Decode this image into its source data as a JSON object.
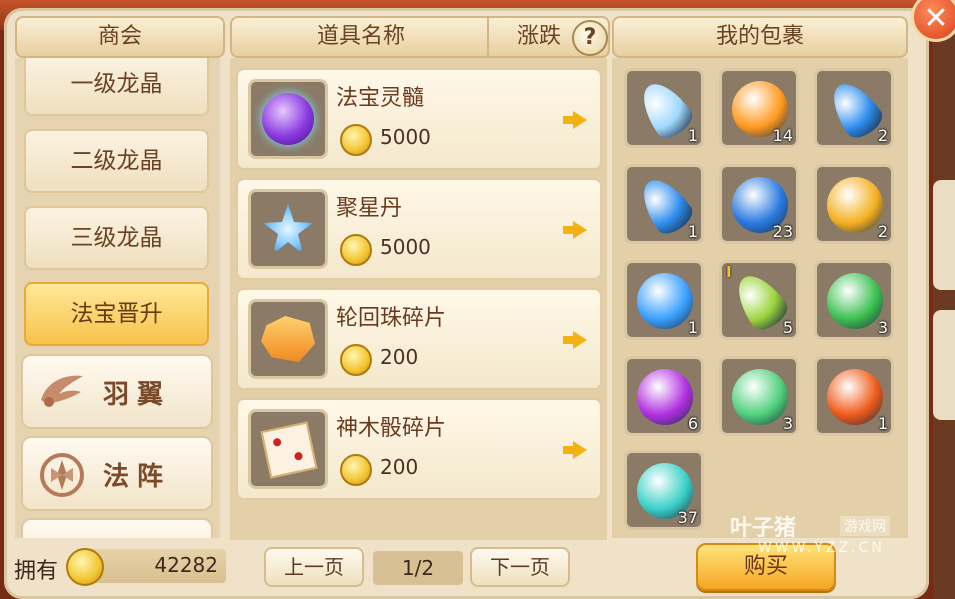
{
  "header": {
    "shop_col": "商会",
    "item_name_col": "道具名称",
    "change_col": "涨跌",
    "help_icon": "?",
    "bag_col": "我的包裹"
  },
  "sidebar": {
    "sub_items": [
      {
        "label": "一级龙晶"
      },
      {
        "label": "二级龙晶"
      },
      {
        "label": "三级龙晶"
      },
      {
        "label": "法宝晋升"
      }
    ],
    "main_items": [
      {
        "label": "羽翼",
        "icon": "wing-icon"
      },
      {
        "label": "法阵",
        "icon": "array-icon"
      }
    ]
  },
  "items": [
    {
      "name": "法宝灵髓",
      "price": "5000",
      "icon": "purple-orb-icon"
    },
    {
      "name": "聚星丹",
      "price": "5000",
      "icon": "star-swirl-icon"
    },
    {
      "name": "轮回珠碎片",
      "price": "200",
      "icon": "orb-fragment-icon"
    },
    {
      "name": "神木骰碎片",
      "price": "200",
      "icon": "dice-fragment-icon"
    }
  ],
  "bag": [
    {
      "count": "1",
      "icon": "ice-crystal-icon",
      "color": "#9fd8ff"
    },
    {
      "count": "14",
      "icon": "fire-orb-icon",
      "color": "#ff9a1f"
    },
    {
      "count": "2",
      "icon": "blue-feather-icon",
      "color": "#2f8ff0"
    },
    {
      "count": "1",
      "icon": "blue-feather-icon",
      "color": "#2f8ff0"
    },
    {
      "count": "23",
      "icon": "blue-orb-icon",
      "color": "#2a7ae0"
    },
    {
      "count": "2",
      "icon": "golden-rose-icon",
      "color": "#f5b020"
    },
    {
      "count": "1",
      "icon": "water-swirl-icon",
      "color": "#3aa0ff"
    },
    {
      "count": "5",
      "icon": "green-crystal-icon",
      "color": "#9bd43a"
    },
    {
      "count": "3",
      "icon": "green-orb-icon",
      "color": "#3cc050"
    },
    {
      "count": "6",
      "icon": "purple-pedestal-orb-icon",
      "color": "#b030e0"
    },
    {
      "count": "3",
      "icon": "rainbow-orb-icon",
      "color": "#4fd07a"
    },
    {
      "count": "1",
      "icon": "fire-spirit-icon",
      "color": "#f05a1a"
    },
    {
      "count": "37",
      "icon": "teal-orb-icon",
      "color": "#3ad0c8"
    }
  ],
  "bag_badge": "I",
  "footer": {
    "own_label": "拥有",
    "own_value": "42282",
    "prev_label": "上一页",
    "page": "1/2",
    "next_label": "下一页",
    "buy_label": "购买"
  },
  "watermark": {
    "brand": "叶子猪",
    "tag": "游戏网",
    "url": "WWW.YZZ.CN"
  }
}
